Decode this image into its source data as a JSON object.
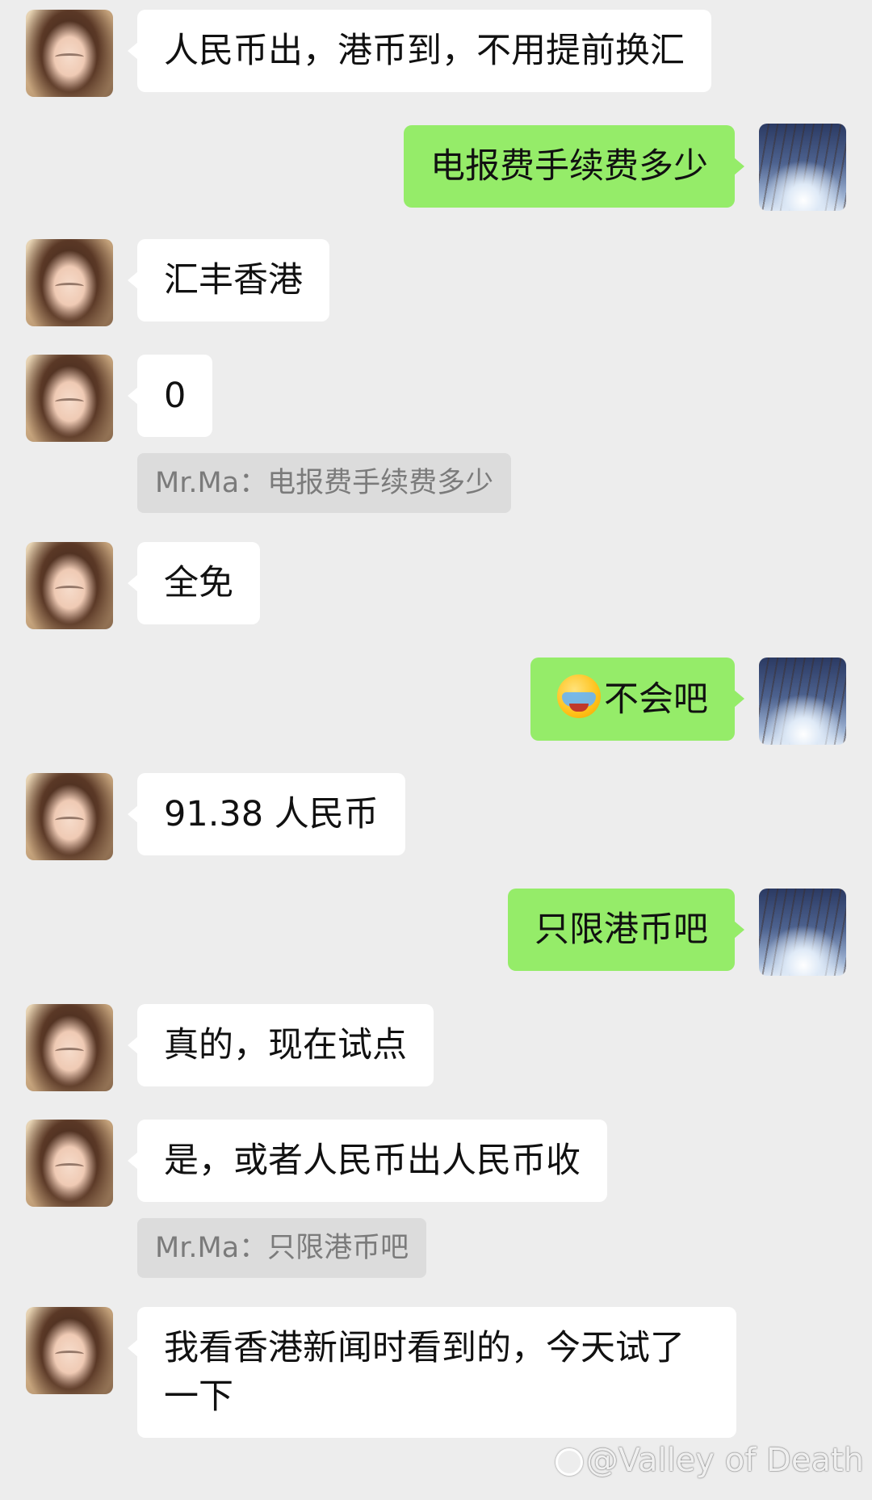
{
  "contacts": {
    "her_avatar": "portrait-avatar",
    "my_avatar": "tree-sky-avatar"
  },
  "messages": [
    {
      "sender": "her",
      "text": "人民币出，港币到，不用提前换汇"
    },
    {
      "sender": "me",
      "text": "电报费手续费多少"
    },
    {
      "sender": "her",
      "text": "汇丰香港"
    },
    {
      "sender": "her",
      "text": "0"
    },
    {
      "quote": "Mr.Ma：电报费手续费多少"
    },
    {
      "sender": "her",
      "text": "全免"
    },
    {
      "sender": "me",
      "emoji": "facepalm-crying-emoji",
      "text": "不会吧"
    },
    {
      "sender": "her",
      "text": "91.38 人民币"
    },
    {
      "sender": "me",
      "text": "只限港币吧"
    },
    {
      "sender": "her",
      "text": "真的，现在试点"
    },
    {
      "sender": "her",
      "text": "是，或者人民币出人民币收"
    },
    {
      "quote": "Mr.Ma：只限港币吧"
    },
    {
      "sender": "her",
      "text": "我看香港新闻时看到的，今天试了一下"
    }
  ],
  "watermark": {
    "text": "@Valley of Death"
  },
  "colors": {
    "background": "#ededed",
    "incoming_bubble": "#ffffff",
    "outgoing_bubble": "#95ec69",
    "quote_bubble": "#dcdcdc"
  }
}
